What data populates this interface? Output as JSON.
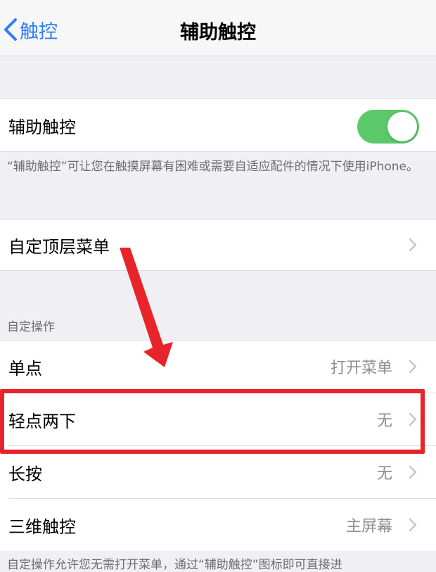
{
  "nav": {
    "back_label": "触控",
    "title": "辅助触控"
  },
  "assistive_touch": {
    "label": "辅助触控",
    "enabled": true,
    "footnote": "“辅助触控”可让您在触摸屏幕有困难或需要自适应配件的情况下使用iPhone。"
  },
  "top_menu": {
    "label": "自定顶层菜单"
  },
  "custom_actions": {
    "header": "自定操作",
    "rows": [
      {
        "label": "单点",
        "value": "打开菜单"
      },
      {
        "label": "轻点两下",
        "value": "无"
      },
      {
        "label": "长按",
        "value": "无"
      },
      {
        "label": "三维触控",
        "value": "主屏幕"
      }
    ],
    "footnote": "自定操作允许您无需打开菜单，通过“辅助触控”图标即可直接进"
  },
  "colors": {
    "accent": "#2f7df6",
    "toggle_on": "#5bc86a",
    "annotation_red": "#e8242b"
  }
}
